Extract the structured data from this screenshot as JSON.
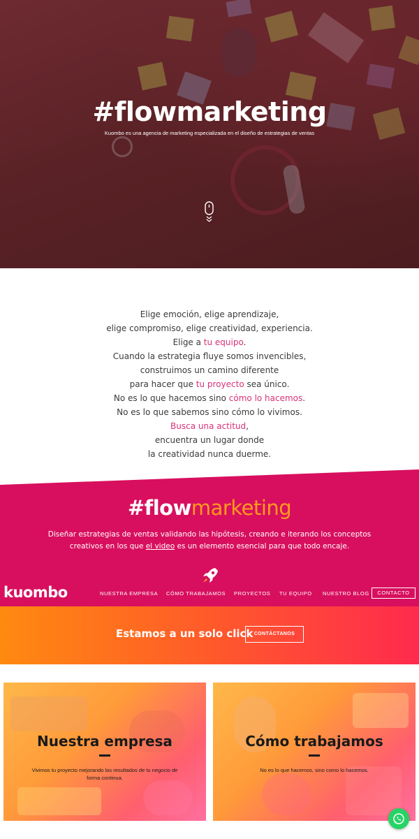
{
  "hero": {
    "title": "#flowmarketing",
    "subtitle": "Kuombo es una agencia de marketing especializada en el diseño de estrategias de ventas"
  },
  "manifesto": {
    "l1": "Elige emoción, elige aprendizaje,",
    "l2": "elige compromiso, elige creatividad, experiencia.",
    "l3a": "Elige a ",
    "l3b": "tu equipo",
    "l3c": ".",
    "l4": "Cuando la estrategia fluye somos invencibles,",
    "l5": "construimos un camino diferente",
    "l6a": "para hacer que ",
    "l6b": "tu proyecto",
    "l6c": " sea único.",
    "l7a": "No es lo que hacemos sino ",
    "l7b": "cómo lo hacemos",
    "l7c": ".",
    "l8": "No es lo que sabemos sino cómo lo vivimos.",
    "l9a": "Busca una actitud",
    "l9b": ",",
    "l10": "encuentra un lugar donde",
    "l11": "la creatividad nunca duerme."
  },
  "pink": {
    "title_a": "#flow",
    "title_b": "marketing",
    "desc_1": "Diseñar estrategias de ventas validando las hipótesis, creando e iterando los conceptos",
    "desc_2a": "creativos en los que ",
    "desc_2b": "el video",
    "desc_2c": " es un elemento esencial para que todo encaje."
  },
  "nav": {
    "logo": "kuombo",
    "items": [
      "NUESTRA EMPRESA",
      "CÓMO TRABAJAMOS",
      "PROYECTOS",
      "TU EQUIPO",
      "NUESTRO BLOG"
    ],
    "contact": "CONTACTO"
  },
  "cta": {
    "text": "Estamos a un solo click",
    "button": "CONTÁCTANOS"
  },
  "cards": [
    {
      "title": "Nuestra empresa",
      "text": "Vivimos tu proyecto mejorando los resultados de tu negocio de forma continua."
    },
    {
      "title": "Cómo trabajamos",
      "text": "No es lo que hacemos, sino como lo hacemos."
    }
  ],
  "colors": {
    "accent_pink": "#d80f5e",
    "accent_orange": "#ff9a1e",
    "link_pink": "#d8327a",
    "whatsapp": "#25d366"
  },
  "icons": {
    "scroll": "mouse-scroll-icon",
    "rocket": "rocket-icon",
    "whatsapp": "whatsapp-icon"
  }
}
